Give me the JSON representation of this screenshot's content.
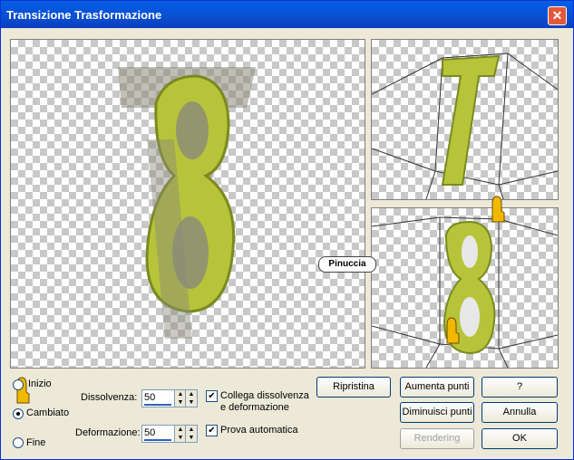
{
  "window": {
    "title": "Transizione Trasformazione",
    "close_label": "✕"
  },
  "watermark": "Pinuccia",
  "modes": {
    "inizio": {
      "label": "Inizio",
      "selected": false
    },
    "cambiato": {
      "label": "Cambiato",
      "selected": true
    },
    "fine": {
      "label": "Fine",
      "selected": false
    }
  },
  "dissolvenza": {
    "label": "Dissolvenza:",
    "value": "50"
  },
  "deformazione": {
    "label": "Deformazione:",
    "value": "50"
  },
  "options": {
    "collega_line1": "Collega dissolvenza",
    "collega_line2": "e deformazione",
    "collega_checked": "✔",
    "prova": "Prova automatica",
    "prova_checked": "✔"
  },
  "buttons": {
    "ripristina": "Ripristina",
    "aumenta": "Aumenta punti",
    "diminuisci": "Diminuisci punti",
    "rendering": "Rendering",
    "help": "?",
    "annulla": "Annulla",
    "ok": "OK"
  },
  "colors": {
    "title_bar": "#0a5fdd",
    "glyph": "#b7c43a",
    "close": "#e2593a"
  }
}
